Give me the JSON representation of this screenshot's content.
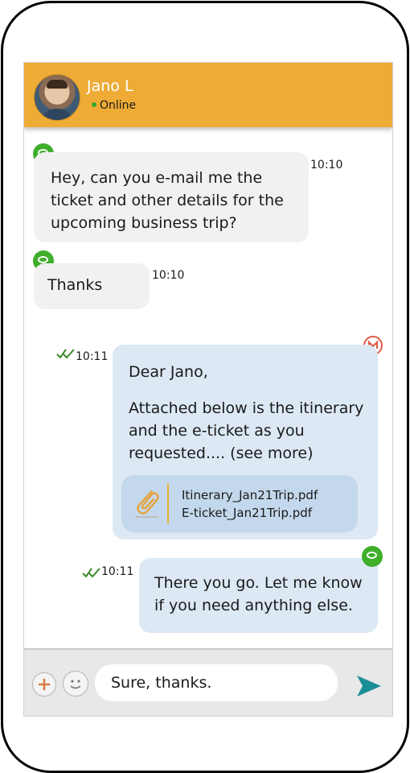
{
  "contact": {
    "name": "Jano L",
    "status": "Online"
  },
  "messages": [
    {
      "direction": "incoming",
      "text": "Hey, can you e-mail me the\nticket and other details for the\nupcoming business trip?",
      "time": "10:10",
      "icon": "chat-icon"
    },
    {
      "direction": "incoming",
      "text": "Thanks",
      "time": "10:10",
      "icon": "chat-icon"
    },
    {
      "direction": "outgoing",
      "icon": "gmail-icon",
      "greeting": "Dear Jano,",
      "text": "Attached below is the itinerary\nand the e-ticket as you\nrequested.... (see more)",
      "time": "10:11",
      "attachments": [
        "Itinerary_Jan21Trip.pdf",
        "E-ticket_Jan21Trip.pdf"
      ]
    },
    {
      "direction": "outgoing",
      "icon": "chat-icon",
      "text": "There you go. Let me know\nif you need anything else.",
      "time": "10:11"
    }
  ],
  "composer": {
    "value": "Sure, thanks."
  },
  "colors": {
    "header": "#eeac37",
    "incoming_bubble": "#f1f1f1",
    "outgoing_bubble": "#dce8f4",
    "send": "#1a8f95",
    "chat_icon": "#3fae2b"
  }
}
